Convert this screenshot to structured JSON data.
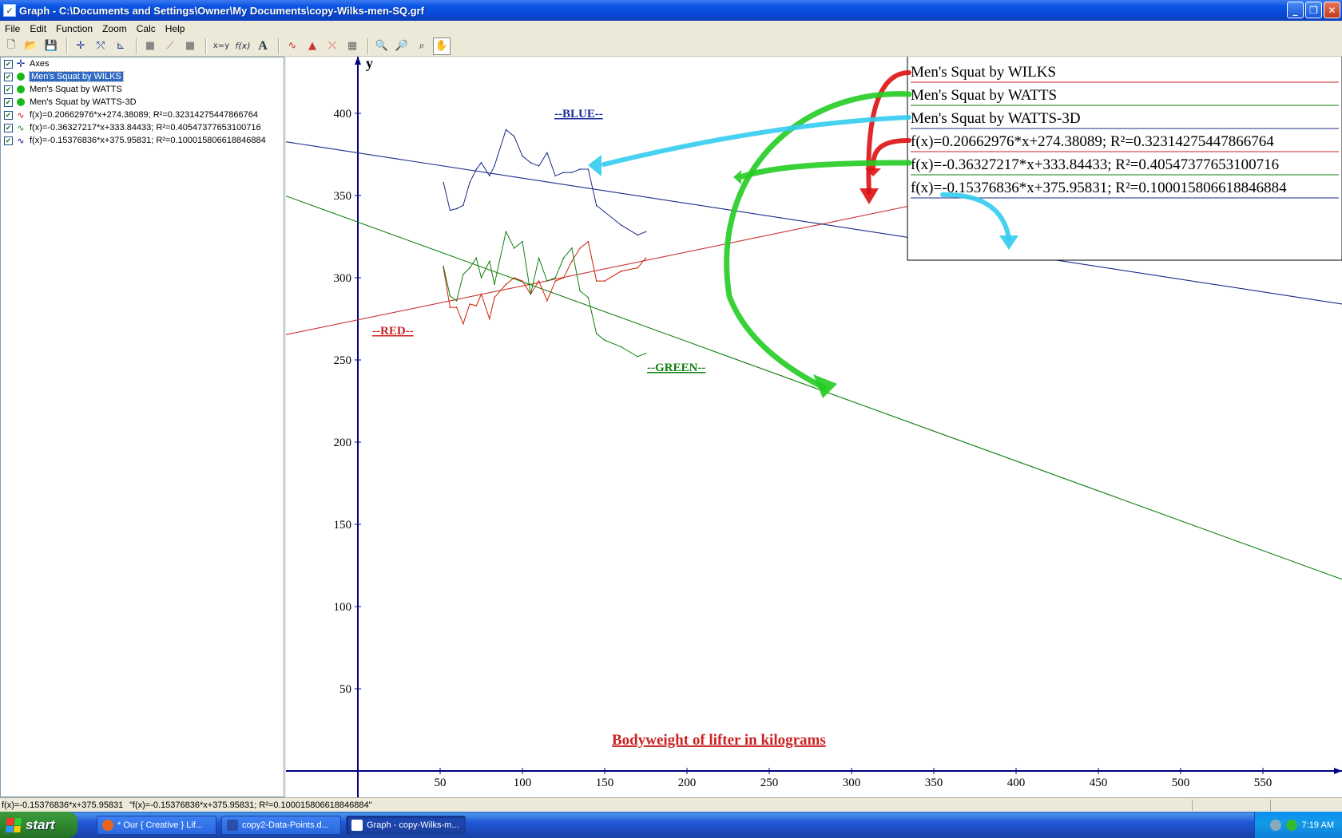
{
  "window": {
    "title": "Graph - C:\\Documents and Settings\\Owner\\My Documents\\copy-Wilks-men-SQ.grf"
  },
  "menu": [
    "File",
    "Edit",
    "Function",
    "Zoom",
    "Calc",
    "Help"
  ],
  "toolbar": {
    "icons": [
      "new-file-icon",
      "open-folder-icon",
      "save-icon",
      "axes-icon",
      "insert-function-icon",
      "insert-tangent-icon",
      "shade-icon",
      "relation-icon",
      "point-series-icon",
      "trendline-icon",
      "custom-function-icon",
      "label-icon",
      "evaluate-icon",
      "area-icon",
      "table-icon",
      "zoom-in-icon",
      "zoom-out-icon",
      "zoom-fit-icon",
      "move-hand-icon"
    ],
    "xy_label": "x=y",
    "fx_label": "f(x)",
    "text_label": "A"
  },
  "functions_panel": {
    "items": [
      {
        "label": "Axes",
        "kind": "axes"
      },
      {
        "label": "Men's Squat by WILKS",
        "kind": "series",
        "color": "#17b817",
        "selected": true
      },
      {
        "label": "Men's Squat by WATTS",
        "kind": "series",
        "color": "#17b817"
      },
      {
        "label": "Men's Squat by WATTS-3D",
        "kind": "series",
        "color": "#17b817"
      },
      {
        "label": "f(x)=0.20662976*x+274.38089; R²=0.32314275447866764",
        "kind": "function",
        "color": "#cc0000"
      },
      {
        "label": "f(x)=-0.36327217*x+333.84433; R²=0.40547377653100716",
        "kind": "function",
        "color": "#108010"
      },
      {
        "label": "f(x)=-0.15376836*x+375.95831; R²=0.100015806618846884",
        "kind": "function",
        "color": "#000080"
      }
    ]
  },
  "graph": {
    "y_axis_label": "y",
    "x_title": "Bodyweight of lifter in kilograms",
    "annotations": {
      "blue": "--BLUE--",
      "red": "--RED--",
      "green": "--GREEN--"
    },
    "legend": [
      "Men's Squat by WILKS",
      "Men's Squat by WATTS",
      "Men's Squat by WATTS-3D",
      "f(x)=0.20662976*x+274.38089; R²=0.32314275447866764",
      "f(x)=-0.36327217*x+333.84433; R²=0.40547377653100716",
      "f(x)=-0.15376836*x+375.95831; R²=0.100015806618846884"
    ]
  },
  "chart_data": {
    "type": "line",
    "title": "",
    "xlabel": "Bodyweight of lifter in kilograms",
    "ylabel": "y",
    "xlim": [
      0,
      590
    ],
    "ylim": [
      0,
      430
    ],
    "x_ticks": [
      50,
      100,
      150,
      200,
      250,
      300,
      350,
      400,
      450,
      500,
      550
    ],
    "y_ticks": [
      50,
      100,
      150,
      200,
      250,
      300,
      350,
      400
    ],
    "series": [
      {
        "name": "Men's Squat by WILKS",
        "color": "#cc2200",
        "x": [
          52,
          56,
          60,
          64,
          68,
          72,
          75,
          80,
          83,
          90,
          95,
          100,
          105,
          110,
          115,
          120,
          125,
          130,
          135,
          140,
          145,
          150,
          160,
          170,
          175
        ],
        "y": [
          306,
          282,
          282,
          272,
          284,
          283,
          290,
          275,
          288,
          296,
          300,
          298,
          290,
          298,
          286,
          298,
          300,
          310,
          318,
          322,
          298,
          298,
          304,
          306,
          312
        ]
      },
      {
        "name": "Men's Squat by WATTS",
        "color": "#108010",
        "x": [
          52,
          56,
          60,
          64,
          68,
          72,
          75,
          80,
          83,
          90,
          95,
          100,
          105,
          110,
          115,
          120,
          125,
          130,
          135,
          140,
          145,
          150,
          160,
          170,
          175
        ],
        "y": [
          307,
          289,
          286,
          302,
          306,
          312,
          300,
          310,
          296,
          328,
          318,
          322,
          290,
          312,
          298,
          300,
          312,
          318,
          292,
          288,
          266,
          262,
          258,
          252,
          254
        ]
      },
      {
        "name": "Men's Squat by WATTS-3D",
        "color": "#1a2a8a",
        "x": [
          52,
          56,
          60,
          64,
          68,
          72,
          75,
          80,
          83,
          90,
          95,
          100,
          105,
          110,
          115,
          120,
          125,
          130,
          135,
          140,
          145,
          150,
          160,
          170,
          175
        ],
        "y": [
          358,
          341,
          342,
          344,
          358,
          366,
          370,
          362,
          368,
          390,
          386,
          374,
          370,
          368,
          376,
          362,
          364,
          364,
          366,
          366,
          344,
          340,
          332,
          326,
          328
        ]
      },
      {
        "name": "f(x)=0.20662976*x+274.38089; R²=0.32314275447866764",
        "color": "#cc3333",
        "slope": 0.20662976,
        "intercept": 274.38089
      },
      {
        "name": "f(x)=-0.36327217*x+333.84433; R²=0.40547377653100716",
        "color": "#108010",
        "slope": -0.36327217,
        "intercept": 333.84433
      },
      {
        "name": "f(x)=-0.15376836*x+375.95831; R²=0.100015806618846884",
        "color": "#1a2a8a",
        "slope": -0.15376836,
        "intercept": 375.95831
      }
    ],
    "grid": false,
    "legend_position": "top-right"
  },
  "statusbar": {
    "left": "f(x)=-0.15376836*x+375.95831",
    "right": "\"f(x)=-0.15376836*x+375.95831; R²=0.100015806618846884\""
  },
  "taskbar": {
    "start_label": "start",
    "items": [
      {
        "label": "* Our { Creative } Lif...",
        "icon_color": "#e8661a"
      },
      {
        "label": "copy2-Data-Points.d...",
        "icon_color": "#2b4ea8"
      },
      {
        "label": "Graph - copy-Wilks-m...",
        "icon_color": "#ffffff",
        "active": true
      }
    ],
    "clock": "7:19 AM"
  }
}
